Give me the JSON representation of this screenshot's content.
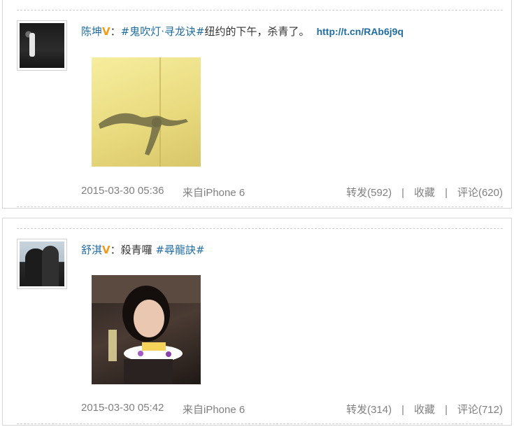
{
  "posts": [
    {
      "author": "陈坤",
      "verified_badge": "V",
      "colon": "：",
      "hashtag": "#鬼吹灯·寻龙诀#",
      "text": "纽约的下午，杀青了。",
      "link": "http://t.cn/RAb6j9q",
      "timestamp": "2015-03-30 05:36",
      "source": "来自iPhone 6",
      "repost_label": "转发(592)",
      "favorite_label": "收藏",
      "comment_label": "评论(620)"
    },
    {
      "author": "舒淇",
      "verified_badge": "V",
      "colon": "：",
      "text": "殺青囉 ",
      "hashtag": "#尋龍訣#",
      "timestamp": "2015-03-30 05:42",
      "source": "来自iPhone 6",
      "repost_label": "转发(314)",
      "favorite_label": "收藏",
      "comment_label": "评论(712)"
    }
  ],
  "separator": "|",
  "colors": {
    "link": "#1f6da3",
    "verified": "#f39a1a",
    "meta": "#808080"
  }
}
